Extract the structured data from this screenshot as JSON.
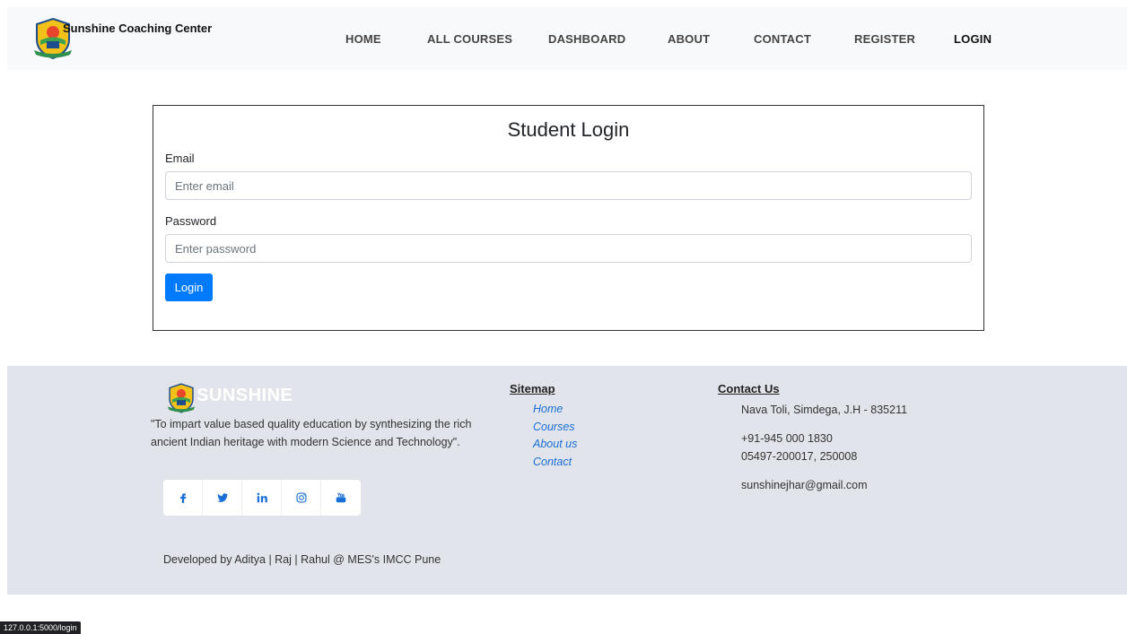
{
  "brand": {
    "name": "Sunshine Coaching Center"
  },
  "nav": {
    "items": [
      {
        "label": "HOME"
      },
      {
        "label": "ALL COURSES"
      },
      {
        "label": "DASHBOARD"
      },
      {
        "label": "ABOUT"
      },
      {
        "label": "CONTACT"
      },
      {
        "label": "REGISTER"
      },
      {
        "label": "LOGIN"
      }
    ]
  },
  "login": {
    "title": "Student Login",
    "email_label": "Email",
    "email_placeholder": "Enter email",
    "email_value": "",
    "password_label": "Password",
    "password_placeholder": "Enter password",
    "password_value": "",
    "button_label": "Login",
    "button_color": "#007bff"
  },
  "footer": {
    "logo_text": "SUNSHINE",
    "quote": "\"To impart value based quality education by synthesizing the rich ancient Indian heritage with modern Science and Technology\".",
    "social_icons": [
      "facebook-icon",
      "twitter-icon",
      "linkedin-icon",
      "instagram-icon",
      "youtube-icon"
    ],
    "developed_by": "Developed by Aditya | Raj | Rahul @ MES's IMCC Pune",
    "sitemap": {
      "title": "Sitemap",
      "links": [
        "Home",
        "Courses",
        "About us",
        "Contact"
      ]
    },
    "contact": {
      "title": "Contact Us",
      "address": "Nava Toli, Simdega, J.H - 835211",
      "phone1": "+91-945 000 1830",
      "phone2": "05497-200017, 250008",
      "email": "sunshinejhar@gmail.com"
    },
    "link_color": "#1a6fd6"
  },
  "status": {
    "url": "127.0.0.1:5000/login"
  }
}
